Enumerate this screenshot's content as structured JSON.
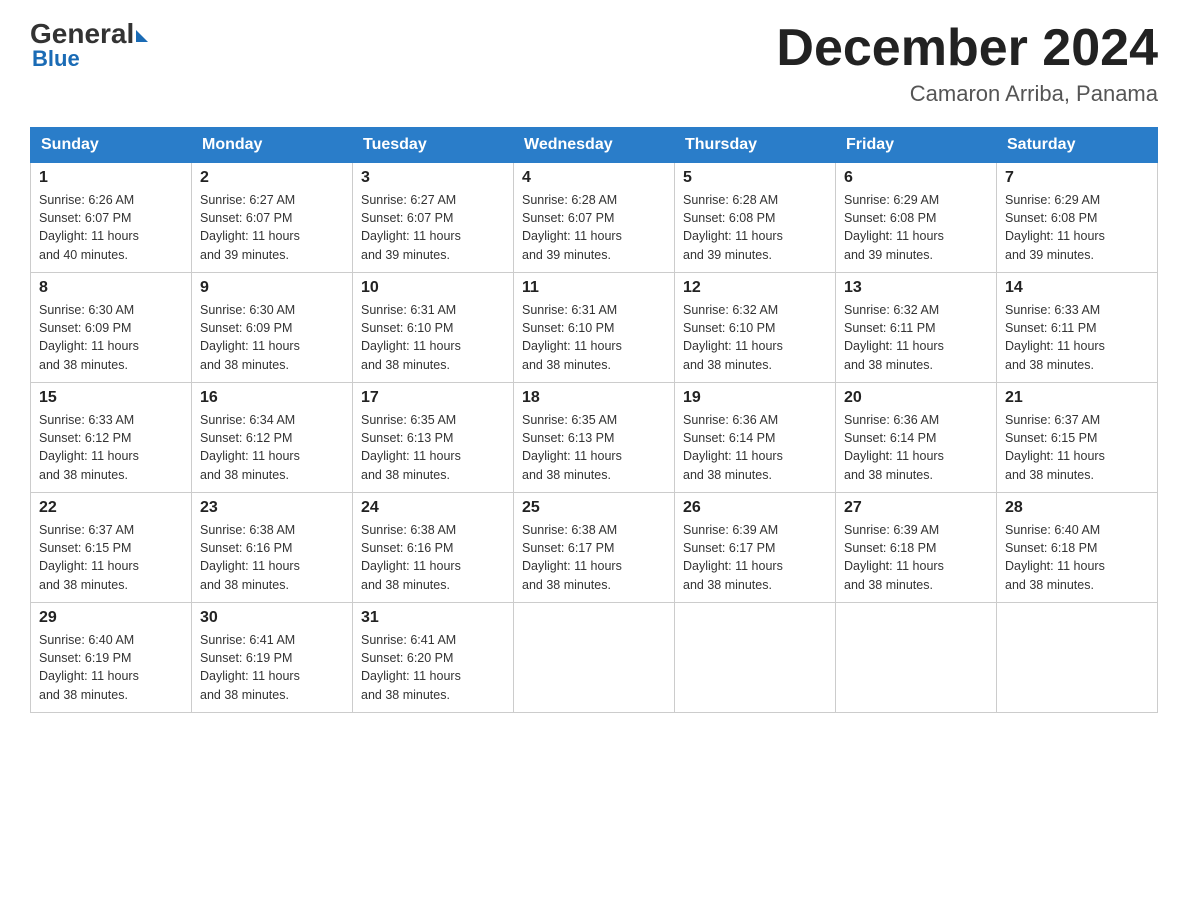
{
  "logo": {
    "general": "General",
    "blue": "Blue"
  },
  "header": {
    "title": "December 2024",
    "subtitle": "Camaron Arriba, Panama"
  },
  "days_of_week": [
    "Sunday",
    "Monday",
    "Tuesday",
    "Wednesday",
    "Thursday",
    "Friday",
    "Saturday"
  ],
  "weeks": [
    [
      {
        "day": "1",
        "sunrise": "6:26 AM",
        "sunset": "6:07 PM",
        "daylight": "11 hours and 40 minutes."
      },
      {
        "day": "2",
        "sunrise": "6:27 AM",
        "sunset": "6:07 PM",
        "daylight": "11 hours and 39 minutes."
      },
      {
        "day": "3",
        "sunrise": "6:27 AM",
        "sunset": "6:07 PM",
        "daylight": "11 hours and 39 minutes."
      },
      {
        "day": "4",
        "sunrise": "6:28 AM",
        "sunset": "6:07 PM",
        "daylight": "11 hours and 39 minutes."
      },
      {
        "day": "5",
        "sunrise": "6:28 AM",
        "sunset": "6:08 PM",
        "daylight": "11 hours and 39 minutes."
      },
      {
        "day": "6",
        "sunrise": "6:29 AM",
        "sunset": "6:08 PM",
        "daylight": "11 hours and 39 minutes."
      },
      {
        "day": "7",
        "sunrise": "6:29 AM",
        "sunset": "6:08 PM",
        "daylight": "11 hours and 39 minutes."
      }
    ],
    [
      {
        "day": "8",
        "sunrise": "6:30 AM",
        "sunset": "6:09 PM",
        "daylight": "11 hours and 38 minutes."
      },
      {
        "day": "9",
        "sunrise": "6:30 AM",
        "sunset": "6:09 PM",
        "daylight": "11 hours and 38 minutes."
      },
      {
        "day": "10",
        "sunrise": "6:31 AM",
        "sunset": "6:10 PM",
        "daylight": "11 hours and 38 minutes."
      },
      {
        "day": "11",
        "sunrise": "6:31 AM",
        "sunset": "6:10 PM",
        "daylight": "11 hours and 38 minutes."
      },
      {
        "day": "12",
        "sunrise": "6:32 AM",
        "sunset": "6:10 PM",
        "daylight": "11 hours and 38 minutes."
      },
      {
        "day": "13",
        "sunrise": "6:32 AM",
        "sunset": "6:11 PM",
        "daylight": "11 hours and 38 minutes."
      },
      {
        "day": "14",
        "sunrise": "6:33 AM",
        "sunset": "6:11 PM",
        "daylight": "11 hours and 38 minutes."
      }
    ],
    [
      {
        "day": "15",
        "sunrise": "6:33 AM",
        "sunset": "6:12 PM",
        "daylight": "11 hours and 38 minutes."
      },
      {
        "day": "16",
        "sunrise": "6:34 AM",
        "sunset": "6:12 PM",
        "daylight": "11 hours and 38 minutes."
      },
      {
        "day": "17",
        "sunrise": "6:35 AM",
        "sunset": "6:13 PM",
        "daylight": "11 hours and 38 minutes."
      },
      {
        "day": "18",
        "sunrise": "6:35 AM",
        "sunset": "6:13 PM",
        "daylight": "11 hours and 38 minutes."
      },
      {
        "day": "19",
        "sunrise": "6:36 AM",
        "sunset": "6:14 PM",
        "daylight": "11 hours and 38 minutes."
      },
      {
        "day": "20",
        "sunrise": "6:36 AM",
        "sunset": "6:14 PM",
        "daylight": "11 hours and 38 minutes."
      },
      {
        "day": "21",
        "sunrise": "6:37 AM",
        "sunset": "6:15 PM",
        "daylight": "11 hours and 38 minutes."
      }
    ],
    [
      {
        "day": "22",
        "sunrise": "6:37 AM",
        "sunset": "6:15 PM",
        "daylight": "11 hours and 38 minutes."
      },
      {
        "day": "23",
        "sunrise": "6:38 AM",
        "sunset": "6:16 PM",
        "daylight": "11 hours and 38 minutes."
      },
      {
        "day": "24",
        "sunrise": "6:38 AM",
        "sunset": "6:16 PM",
        "daylight": "11 hours and 38 minutes."
      },
      {
        "day": "25",
        "sunrise": "6:38 AM",
        "sunset": "6:17 PM",
        "daylight": "11 hours and 38 minutes."
      },
      {
        "day": "26",
        "sunrise": "6:39 AM",
        "sunset": "6:17 PM",
        "daylight": "11 hours and 38 minutes."
      },
      {
        "day": "27",
        "sunrise": "6:39 AM",
        "sunset": "6:18 PM",
        "daylight": "11 hours and 38 minutes."
      },
      {
        "day": "28",
        "sunrise": "6:40 AM",
        "sunset": "6:18 PM",
        "daylight": "11 hours and 38 minutes."
      }
    ],
    [
      {
        "day": "29",
        "sunrise": "6:40 AM",
        "sunset": "6:19 PM",
        "daylight": "11 hours and 38 minutes."
      },
      {
        "day": "30",
        "sunrise": "6:41 AM",
        "sunset": "6:19 PM",
        "daylight": "11 hours and 38 minutes."
      },
      {
        "day": "31",
        "sunrise": "6:41 AM",
        "sunset": "6:20 PM",
        "daylight": "11 hours and 38 minutes."
      },
      null,
      null,
      null,
      null
    ]
  ],
  "labels": {
    "sunrise": "Sunrise:",
    "sunset": "Sunset:",
    "daylight": "Daylight:"
  }
}
